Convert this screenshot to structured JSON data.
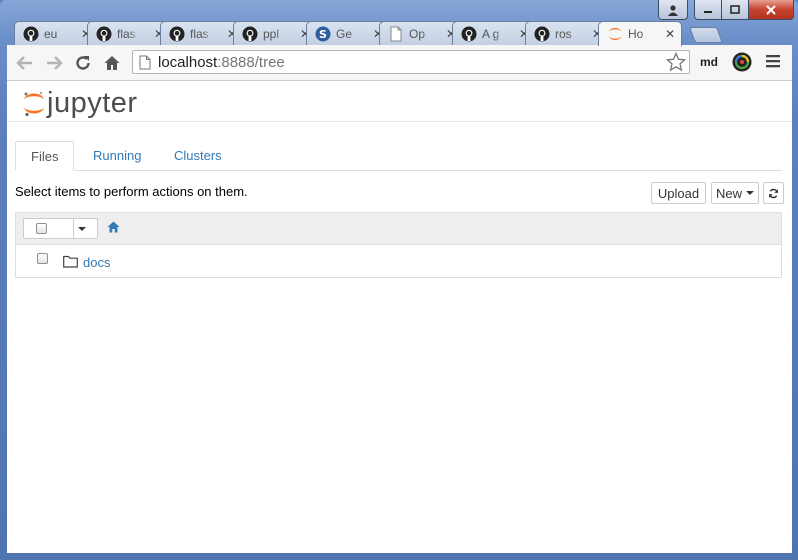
{
  "browser": {
    "tabs": [
      {
        "icon": "github-icon",
        "title": "eu"
      },
      {
        "icon": "github-icon",
        "title": "flas"
      },
      {
        "icon": "github-icon",
        "title": "flas"
      },
      {
        "icon": "github-icon",
        "title": "ppl"
      },
      {
        "icon": "blue-s-icon",
        "title": "Ge"
      },
      {
        "icon": "page-icon",
        "title": "Op"
      },
      {
        "icon": "github-icon",
        "title": "A g"
      },
      {
        "icon": "github-icon",
        "title": "ros"
      },
      {
        "icon": "jupyter-icon",
        "title": "Ho"
      }
    ],
    "url_host": "localhost",
    "url_path": ":8888/tree",
    "profile": "md"
  },
  "jupyter": {
    "logo_text": "jupyter",
    "tabs": [
      "Files",
      "Running",
      "Clusters"
    ],
    "hint": "Select items to perform actions on them.",
    "upload_label": "Upload",
    "new_label": "New",
    "items": [
      {
        "name": "docs",
        "type": "folder"
      }
    ]
  },
  "colors": {
    "link": "#337ab7",
    "jupyter_orange": "#f37726"
  }
}
